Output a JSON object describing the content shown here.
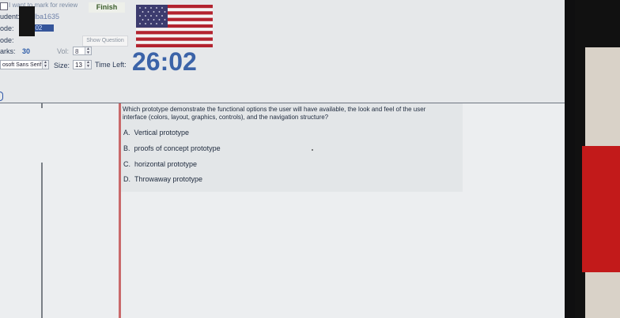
{
  "header": {
    "checkbox_label": "I want to mark for review",
    "finish_label": "Finish",
    "student_label": "udent:",
    "student_value": "dba1635",
    "code_label": "ode:",
    "code_value": "502",
    "code2_label": "ode:",
    "show_question_label": "Show Question",
    "marks_label": "arks:",
    "marks_value": "30",
    "vol_label": "Vol:",
    "vol_value": "8",
    "font_value": "osoft Sans Serif",
    "size_label": "Size:",
    "size_value": "13",
    "time_left_label": "Time Left:",
    "timer": "26:02"
  },
  "question": {
    "text": "Which prototype demonstrate the functional options the user will have available, the look and feel of the user interface (colors, layout, graphics, controls), and the navigation structure?",
    "options": [
      {
        "letter": "A.",
        "text": "Vertical prototype"
      },
      {
        "letter": "B.",
        "text": "proofs of concept prototype"
      },
      {
        "letter": "C.",
        "text": "horizontal prototype"
      },
      {
        "letter": "D.",
        "text": "Throwaway prototype"
      }
    ]
  },
  "colors": {
    "timer": "#3b63a8",
    "marks": "#2d5ca8",
    "red_line": "#c9696a"
  },
  "icons": [
    "us-flag-icon",
    "checkbox-icon",
    "spinner-icon"
  ]
}
